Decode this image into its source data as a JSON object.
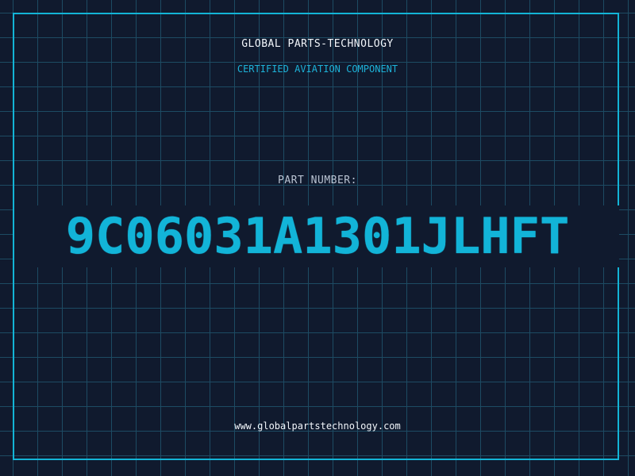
{
  "header": {
    "title": "GLOBAL PARTS-TECHNOLOGY",
    "subtitle": "CERTIFIED AVIATION COMPONENT"
  },
  "part": {
    "label": "PART NUMBER:",
    "number": "9C06031A1301JLHFT"
  },
  "footer": {
    "url": "www.globalpartstechnology.com"
  },
  "colors": {
    "background": "#101a2e",
    "grid": "#1d4b63",
    "accent": "#13b4d6",
    "text": "#f2f6fb",
    "label": "#b9c3d2"
  }
}
